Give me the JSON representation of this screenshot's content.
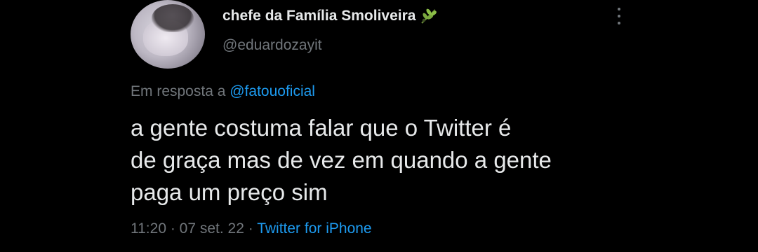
{
  "tweet": {
    "author": {
      "display_name": "chefe da Família Smoliveira",
      "name_emoji": "olive-branch-icon",
      "handle": "@eduardozayit"
    },
    "reply": {
      "prefix": "Em resposta a ",
      "mention": "@fatouoficial"
    },
    "text_lines": [
      "a gente costuma falar que o Twitter é",
      "de graça mas de vez em quando a gente",
      "paga um preço sim"
    ],
    "meta": {
      "time": "11:20",
      "separator1": " · ",
      "date": "07 set. 22",
      "separator2": " · ",
      "source": "Twitter for iPhone"
    }
  },
  "colors": {
    "background": "#000000",
    "text_primary": "#e7e9ea",
    "text_secondary": "#71767b",
    "accent": "#1d9bf0"
  }
}
